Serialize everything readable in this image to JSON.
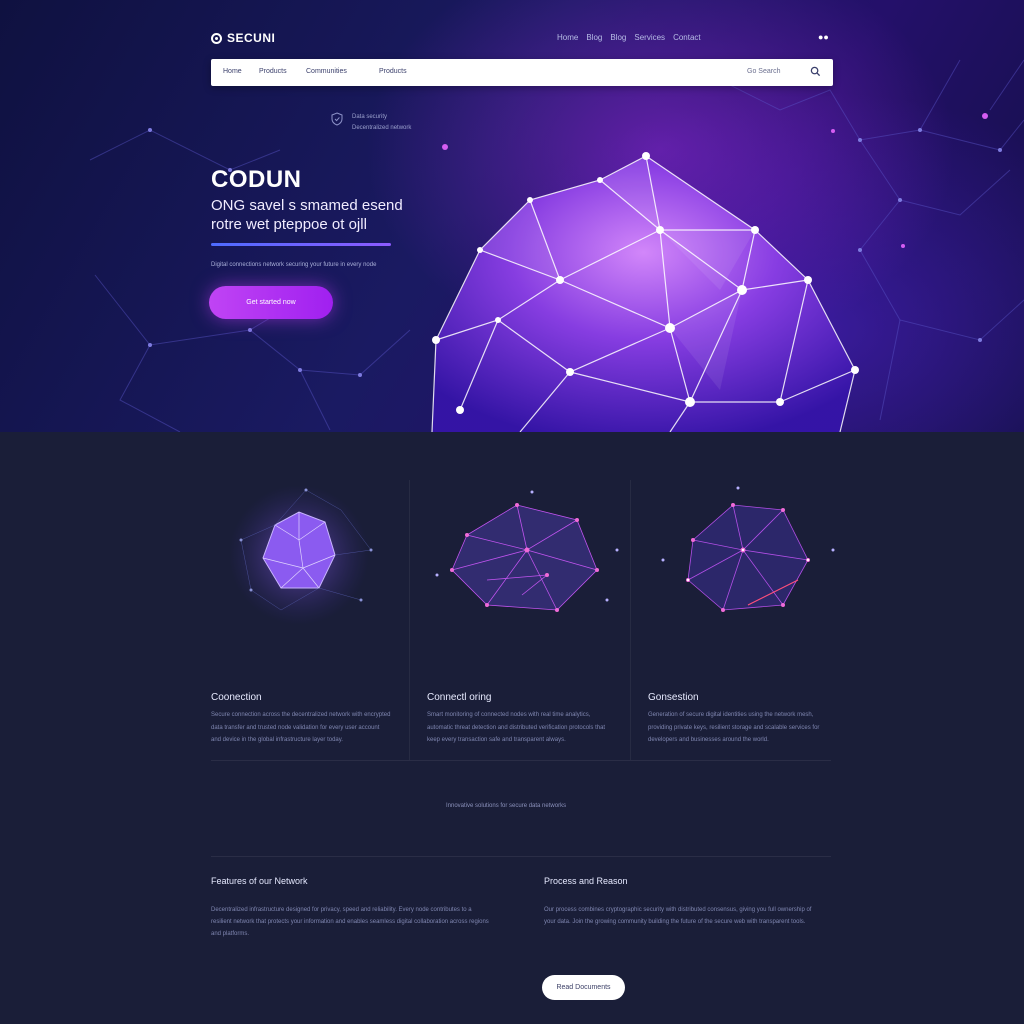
{
  "brand": {
    "name": "SECUNI"
  },
  "nav": {
    "items": [
      "Home",
      "Blog",
      "Blog",
      "Services",
      "Contact"
    ],
    "toggle": "●●"
  },
  "searchbar": {
    "tabs": [
      "Home",
      "Products",
      "Communities",
      "Products"
    ],
    "hint": "Go Search"
  },
  "hero": {
    "badge_line1": "Data security",
    "badge_line2": "Decentralized network",
    "title": "CODUN",
    "subtitle_line1": "ONG savel s smamed esend",
    "subtitle_line2": "rotre wet pteppoe ot ojll",
    "caption": "Digital connections network securing your future in every node",
    "cta_label": "Get started now"
  },
  "features": [
    {
      "title": "Coonection",
      "body": "Secure connection across the decentralized network with encrypted data transfer and trusted node validation for every user account and device in the global infrastructure layer today."
    },
    {
      "title": "Connectl oring",
      "body": "Smart monitoring of connected nodes with real time analytics, automatic threat detection and distributed verification protocols that keep every transaction safe and transparent always."
    },
    {
      "title": "Gonsestion",
      "body": "Generation of secure digital identities using the network mesh, providing private keys, resilient storage and scalable services for developers and businesses around the world."
    }
  ],
  "mid_caption": "Innovative solutions for secure data networks",
  "sections": [
    {
      "title": "Features of our Network",
      "body": "Decentralized infrastructure designed for privacy, speed and reliability. Every node contributes to a resilient network that protects your information and enables seamless digital collaboration across regions and platforms."
    },
    {
      "title": "Process and Reason",
      "body": "Our process combines cryptographic security with distributed consensus, giving you full ownership of your data. Join the growing community building the future of the secure web with transparent tools."
    }
  ],
  "bottom_button": "Read Documents",
  "colors": {
    "accent": "#b63cf2",
    "hero_bg": "#141552",
    "page_bg": "#1a1e38"
  }
}
